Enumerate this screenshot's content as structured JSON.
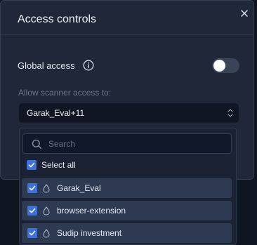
{
  "modal": {
    "title": "Access controls",
    "close_icon": "close-icon"
  },
  "global_access": {
    "label": "Global access",
    "info_icon": "info-icon",
    "enabled": false
  },
  "scanner_access": {
    "label": "Allow scanner access to:",
    "selected_value": "Garak_Eval+11"
  },
  "dropdown": {
    "search_placeholder": "Search",
    "search_value": "",
    "select_all_label": "Select all",
    "select_all_checked": true,
    "options": [
      {
        "label": "Garak_Eval",
        "checked": true,
        "icon": "drop-icon"
      },
      {
        "label": "browser-extension",
        "checked": true,
        "icon": "drop-icon"
      },
      {
        "label": "Sudip investment",
        "checked": true,
        "icon": "drop-icon"
      }
    ]
  },
  "colors": {
    "modal_bg": "#1f2739",
    "checkbox": "#3d72d9",
    "option_bg": "#2e3a52"
  }
}
